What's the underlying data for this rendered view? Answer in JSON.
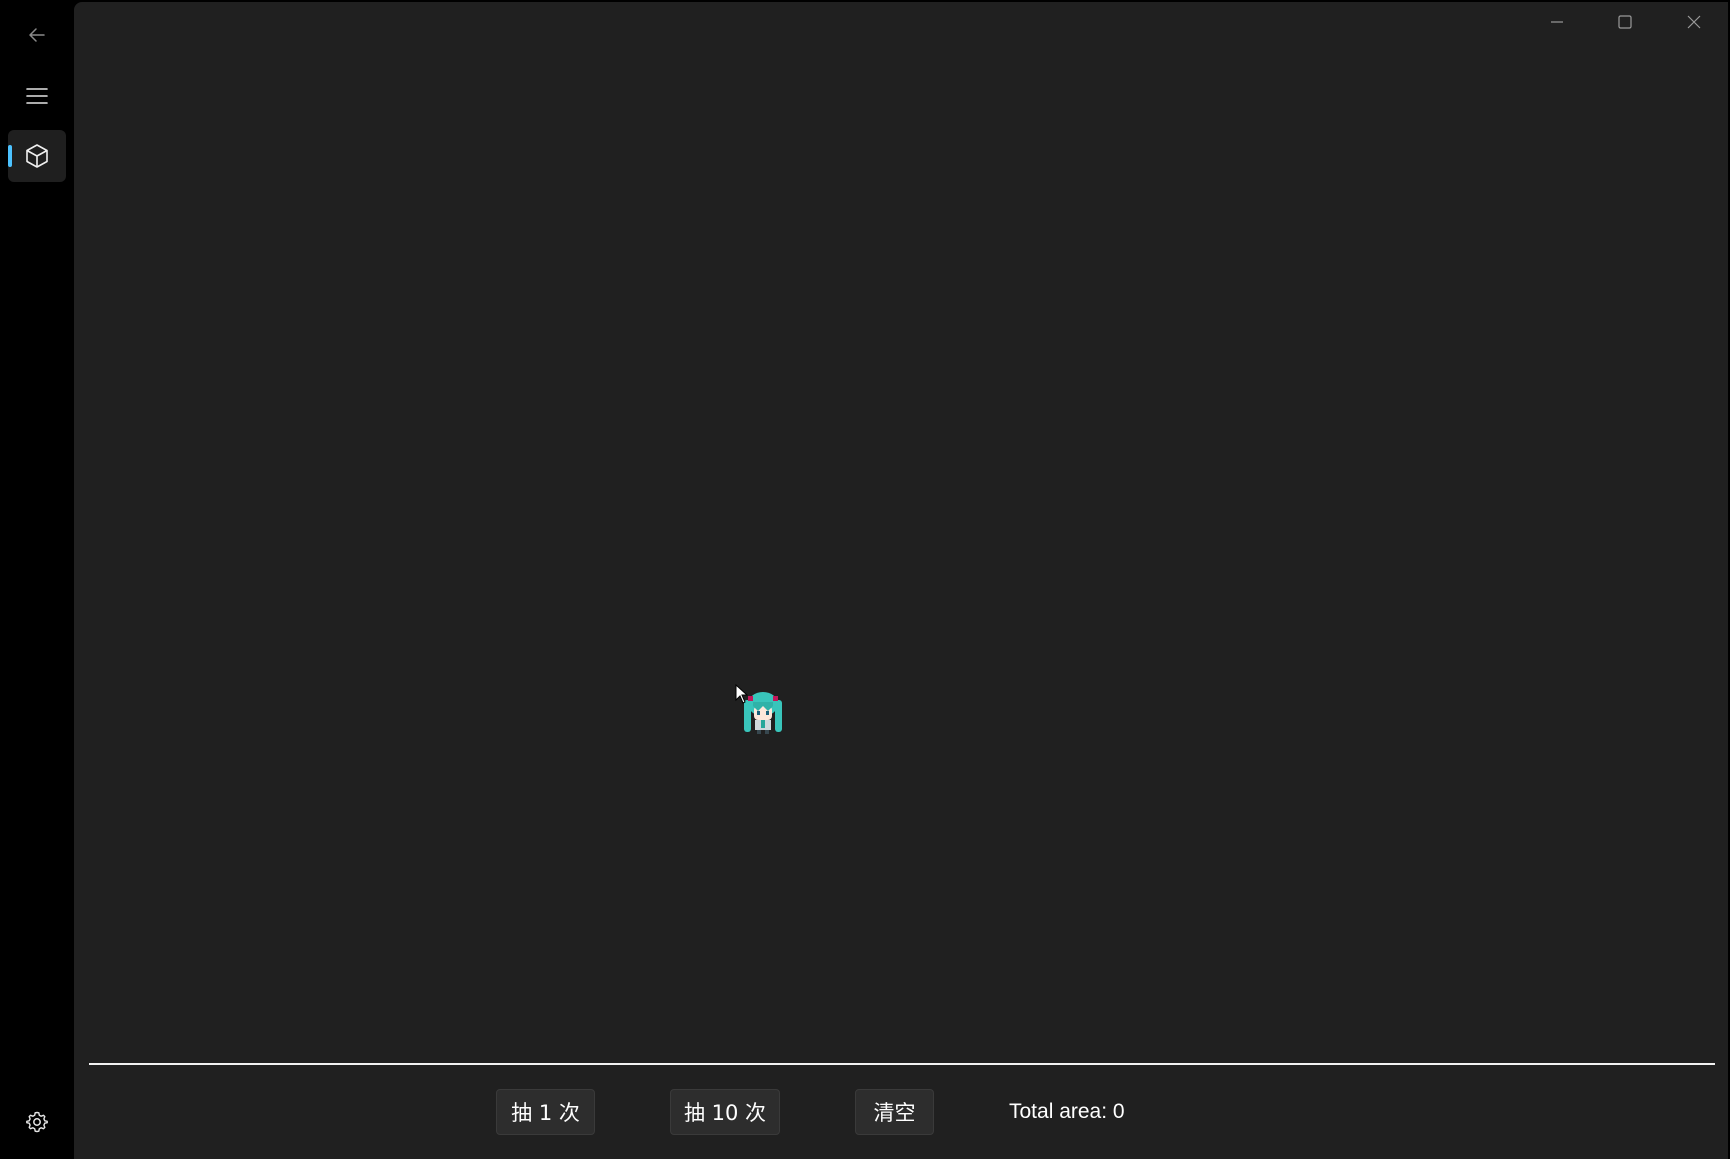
{
  "sidebar": {
    "back_icon": "back-arrow-icon",
    "menu_icon": "hamburger-menu-icon",
    "items": [
      {
        "icon": "cube-icon",
        "selected": true
      }
    ],
    "settings_icon": "gear-icon",
    "accent_color": "#4cc2ff"
  },
  "titlebar": {
    "minimize_icon": "minimize-icon",
    "maximize_icon": "maximize-icon",
    "close_icon": "close-icon"
  },
  "canvas": {
    "sprite_icon": "chibi-character-sprite",
    "cursor_icon": "mouse-pointer-icon",
    "background": "#202020"
  },
  "toolbar": {
    "draw_once_label": "抽 1 次",
    "draw_ten_label": "抽 10 次",
    "clear_label": "清空",
    "total_area_text": "Total area: 0"
  }
}
